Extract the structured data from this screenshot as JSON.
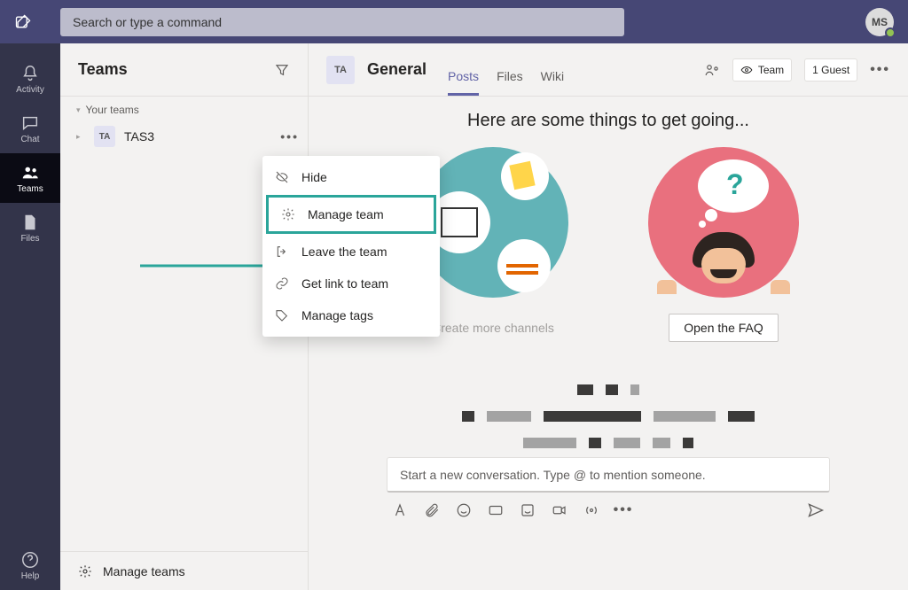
{
  "search": {
    "placeholder": "Search or type a command"
  },
  "avatar": {
    "initials": "MS"
  },
  "rail": [
    {
      "id": "activity",
      "label": "Activity"
    },
    {
      "id": "chat",
      "label": "Chat"
    },
    {
      "id": "teams",
      "label": "Teams"
    },
    {
      "id": "files",
      "label": "Files"
    }
  ],
  "rail_help": {
    "label": "Help"
  },
  "teams_panel": {
    "title": "Teams",
    "section_label": "Your teams",
    "team": {
      "tile": "TA",
      "name": "TAS3"
    },
    "footer": "Manage teams"
  },
  "context_menu": [
    {
      "id": "hide",
      "label": "Hide"
    },
    {
      "id": "manage",
      "label": "Manage team",
      "highlight": true
    },
    {
      "id": "leave",
      "label": "Leave the team"
    },
    {
      "id": "link",
      "label": "Get link to team"
    },
    {
      "id": "tags",
      "label": "Manage tags"
    }
  ],
  "channel_header": {
    "tile": "TA",
    "name": "General",
    "tabs": [
      {
        "id": "posts",
        "label": "Posts",
        "active": true
      },
      {
        "id": "files",
        "label": "Files"
      },
      {
        "id": "wiki",
        "label": "Wiki"
      }
    ],
    "visibility_label": "Team",
    "guest_label": "1 Guest"
  },
  "welcome": {
    "title": "Here are some things to get going...",
    "card1_button": "Create more channels",
    "card2_button": "Open the FAQ"
  },
  "compose": {
    "placeholder": "Start a new conversation. Type @ to mention someone."
  }
}
